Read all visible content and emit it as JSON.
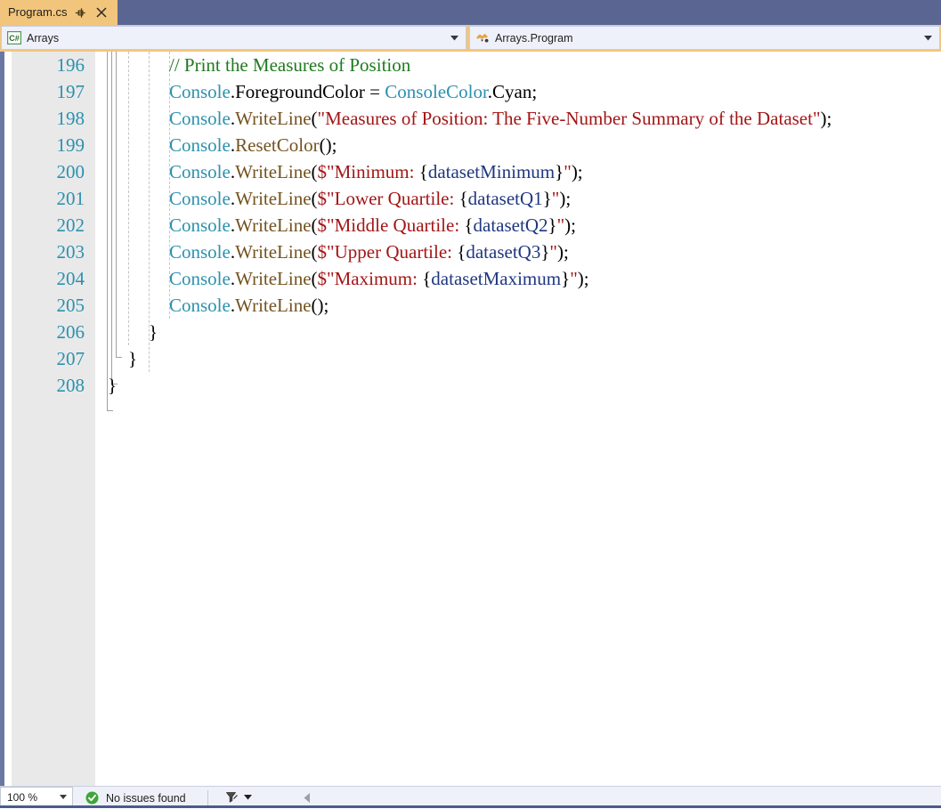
{
  "window": {
    "tab": {
      "title": "Program.cs",
      "pin_icon": "pin-icon",
      "close_icon": "close-icon"
    }
  },
  "navbar": {
    "project_combo": {
      "icon": "csharp-project-icon",
      "value": "Arrays",
      "arrow_icon": "chevron-down-icon"
    },
    "type_combo": {
      "icon": "class-member-icon",
      "value": "Arrays.Program",
      "arrow_icon": "chevron-down-icon"
    }
  },
  "editor": {
    "first_line_number": 196,
    "lines": [
      {
        "number": "196",
        "indent": 3,
        "tokens": [
          {
            "t": "// Print the Measures of Position",
            "c": "c-comment"
          }
        ]
      },
      {
        "number": "197",
        "indent": 3,
        "tokens": [
          {
            "t": "Console",
            "c": "c-type"
          },
          {
            "t": ".",
            "c": "c-plain"
          },
          {
            "t": "ForegroundColor",
            "c": "c-plain"
          },
          {
            "t": " = ",
            "c": "c-plain"
          },
          {
            "t": "ConsoleColor",
            "c": "c-type"
          },
          {
            "t": ".",
            "c": "c-plain"
          },
          {
            "t": "Cyan",
            "c": "c-plain"
          },
          {
            "t": ";",
            "c": "c-plain"
          }
        ]
      },
      {
        "number": "198",
        "indent": 3,
        "tokens": [
          {
            "t": "Console",
            "c": "c-type"
          },
          {
            "t": ".",
            "c": "c-plain"
          },
          {
            "t": "WriteLine",
            "c": "c-member"
          },
          {
            "t": "(",
            "c": "c-plain"
          },
          {
            "t": "\"Measures of Position: The Five-Number Summary of the Dataset\"",
            "c": "c-string"
          },
          {
            "t": ");",
            "c": "c-plain"
          }
        ]
      },
      {
        "number": "199",
        "indent": 3,
        "tokens": [
          {
            "t": "Console",
            "c": "c-type"
          },
          {
            "t": ".",
            "c": "c-plain"
          },
          {
            "t": "ResetColor",
            "c": "c-member"
          },
          {
            "t": "();",
            "c": "c-plain"
          }
        ]
      },
      {
        "number": "200",
        "indent": 3,
        "tokens": [
          {
            "t": "Console",
            "c": "c-type"
          },
          {
            "t": ".",
            "c": "c-plain"
          },
          {
            "t": "WriteLine",
            "c": "c-member"
          },
          {
            "t": "(",
            "c": "c-plain"
          },
          {
            "t": "$\"Minimum: ",
            "c": "c-string"
          },
          {
            "t": "{",
            "c": "c-plain"
          },
          {
            "t": "datasetMinimum",
            "c": "c-var"
          },
          {
            "t": "}",
            "c": "c-plain"
          },
          {
            "t": "\"",
            "c": "c-string"
          },
          {
            "t": ");",
            "c": "c-plain"
          }
        ]
      },
      {
        "number": "201",
        "indent": 3,
        "tokens": [
          {
            "t": "Console",
            "c": "c-type"
          },
          {
            "t": ".",
            "c": "c-plain"
          },
          {
            "t": "WriteLine",
            "c": "c-member"
          },
          {
            "t": "(",
            "c": "c-plain"
          },
          {
            "t": "$\"Lower Quartile: ",
            "c": "c-string"
          },
          {
            "t": "{",
            "c": "c-plain"
          },
          {
            "t": "datasetQ1",
            "c": "c-var"
          },
          {
            "t": "}",
            "c": "c-plain"
          },
          {
            "t": "\"",
            "c": "c-string"
          },
          {
            "t": ");",
            "c": "c-plain"
          }
        ]
      },
      {
        "number": "202",
        "indent": 3,
        "tokens": [
          {
            "t": "Console",
            "c": "c-type"
          },
          {
            "t": ".",
            "c": "c-plain"
          },
          {
            "t": "WriteLine",
            "c": "c-member"
          },
          {
            "t": "(",
            "c": "c-plain"
          },
          {
            "t": "$\"Middle Quartile: ",
            "c": "c-string"
          },
          {
            "t": "{",
            "c": "c-plain"
          },
          {
            "t": "datasetQ2",
            "c": "c-var"
          },
          {
            "t": "}",
            "c": "c-plain"
          },
          {
            "t": "\"",
            "c": "c-string"
          },
          {
            "t": ");",
            "c": "c-plain"
          }
        ]
      },
      {
        "number": "203",
        "indent": 3,
        "tokens": [
          {
            "t": "Console",
            "c": "c-type"
          },
          {
            "t": ".",
            "c": "c-plain"
          },
          {
            "t": "WriteLine",
            "c": "c-member"
          },
          {
            "t": "(",
            "c": "c-plain"
          },
          {
            "t": "$\"Upper Quartile: ",
            "c": "c-string"
          },
          {
            "t": "{",
            "c": "c-plain"
          },
          {
            "t": "datasetQ3",
            "c": "c-var"
          },
          {
            "t": "}",
            "c": "c-plain"
          },
          {
            "t": "\"",
            "c": "c-string"
          },
          {
            "t": ");",
            "c": "c-plain"
          }
        ]
      },
      {
        "number": "204",
        "indent": 3,
        "tokens": [
          {
            "t": "Console",
            "c": "c-type"
          },
          {
            "t": ".",
            "c": "c-plain"
          },
          {
            "t": "WriteLine",
            "c": "c-member"
          },
          {
            "t": "(",
            "c": "c-plain"
          },
          {
            "t": "$\"Maximum: ",
            "c": "c-string"
          },
          {
            "t": "{",
            "c": "c-plain"
          },
          {
            "t": "datasetMaximum",
            "c": "c-var"
          },
          {
            "t": "}",
            "c": "c-plain"
          },
          {
            "t": "\"",
            "c": "c-string"
          },
          {
            "t": ");",
            "c": "c-plain"
          }
        ]
      },
      {
        "number": "205",
        "indent": 3,
        "tokens": [
          {
            "t": "Console",
            "c": "c-type"
          },
          {
            "t": ".",
            "c": "c-plain"
          },
          {
            "t": "WriteLine",
            "c": "c-member"
          },
          {
            "t": "();",
            "c": "c-plain"
          }
        ]
      },
      {
        "number": "206",
        "indent": 2,
        "tokens": [
          {
            "t": "}",
            "c": "c-brace"
          }
        ]
      },
      {
        "number": "207",
        "indent": 1,
        "tokens": [
          {
            "t": "}",
            "c": "c-brace"
          }
        ]
      },
      {
        "number": "208",
        "indent": 0,
        "tokens": [
          {
            "t": "}",
            "c": "c-brace"
          }
        ]
      }
    ]
  },
  "statusbar": {
    "zoom": {
      "value": "100 %",
      "arrow_icon": "chevron-down-icon"
    },
    "issues": {
      "icon": "check-circle-icon",
      "label": "No issues found"
    },
    "filter_icon": "filter-clear-icon",
    "filter_arrow_icon": "chevron-down-icon",
    "back_icon": "chevron-left-icon"
  },
  "colors": {
    "tab_active_bg": "#f2c57c",
    "tabstrip_bg": "#5a6691",
    "margin_bg": "#e9e9e9",
    "lineno_fg": "#2b91af",
    "comment": "#1f7a1f",
    "type": "#2b91af",
    "member": "#74531f",
    "string": "#a31515",
    "variable": "#1f377f",
    "statusbar_bg": "#eef1f8",
    "statusbar_accent": "#4b5b8f",
    "indicator_strip": "#6b77a3"
  }
}
